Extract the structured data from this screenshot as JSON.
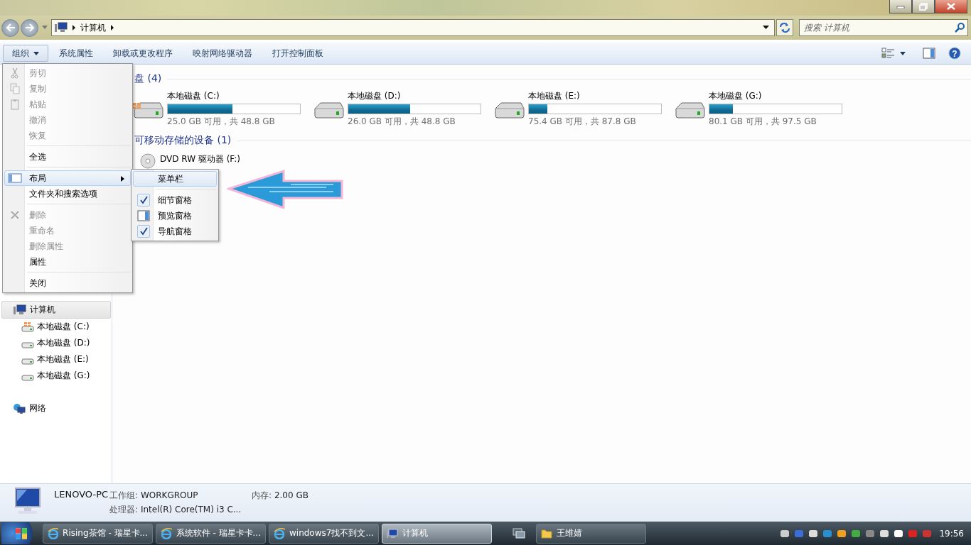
{
  "address": {
    "breadcrumb": [
      "计算机"
    ]
  },
  "search": {
    "placeholder": "搜索 计算机"
  },
  "toolbar": {
    "buttons": [
      {
        "label": "组织",
        "kind": "dropdown",
        "pressed": true
      },
      {
        "label": "系统属性",
        "kind": "plain",
        "pressed": false
      },
      {
        "label": "卸载或更改程序",
        "kind": "plain",
        "pressed": false
      },
      {
        "label": "映射网络驱动器",
        "kind": "plain",
        "pressed": false
      },
      {
        "label": "打开控制面板",
        "kind": "plain",
        "pressed": false
      }
    ],
    "help": "?"
  },
  "menu": {
    "items": [
      {
        "kind": "item",
        "label": "剪切",
        "disabled": true,
        "highlighted": false
      },
      {
        "kind": "item",
        "label": "复制",
        "disabled": true,
        "highlighted": false
      },
      {
        "kind": "item",
        "label": "粘贴",
        "disabled": true,
        "highlighted": false
      },
      {
        "kind": "item",
        "label": "撤消",
        "disabled": true,
        "highlighted": false
      },
      {
        "kind": "item",
        "label": "恢复",
        "disabled": true,
        "highlighted": false
      },
      {
        "kind": "separator"
      },
      {
        "kind": "item",
        "label": "全选",
        "disabled": false,
        "highlighted": false
      },
      {
        "kind": "separator"
      },
      {
        "kind": "submenu",
        "label": "布局",
        "disabled": false,
        "highlighted": true
      },
      {
        "kind": "item",
        "label": "文件夹和搜索选项",
        "disabled": false,
        "highlighted": false
      },
      {
        "kind": "separator"
      },
      {
        "kind": "item",
        "label": "删除",
        "disabled": true,
        "highlighted": false
      },
      {
        "kind": "item",
        "label": "重命名",
        "disabled": true,
        "highlighted": false
      },
      {
        "kind": "item",
        "label": "删除属性",
        "disabled": true,
        "highlighted": false
      },
      {
        "kind": "item",
        "label": "属性",
        "disabled": false,
        "highlighted": false
      },
      {
        "kind": "separator"
      },
      {
        "kind": "item",
        "label": "关闭",
        "disabled": false,
        "highlighted": false
      }
    ]
  },
  "submenu": {
    "items": [
      {
        "kind": "plain",
        "label": "菜单栏",
        "checked": false,
        "highlighted": true
      },
      {
        "kind": "separator"
      },
      {
        "kind": "plain",
        "label": "细节窗格",
        "checked": true,
        "highlighted": false
      },
      {
        "kind": "pane",
        "label": "预览窗格",
        "checked": false,
        "highlighted": false
      },
      {
        "kind": "plain",
        "label": "导航窗格",
        "checked": true,
        "highlighted": false
      }
    ]
  },
  "sections": [
    {
      "title": "盘 (4)",
      "drives": [
        {
          "kind": "system",
          "name": "本地磁盘 (C:)",
          "level": 0.49,
          "free": "25.0 GB 可用，共 48.8 GB"
        },
        {
          "kind": "data",
          "name": "本地磁盘 (D:)",
          "level": 0.47,
          "free": "26.0 GB 可用，共 48.8 GB"
        },
        {
          "kind": "data",
          "name": "本地磁盘 (E:)",
          "level": 0.14,
          "free": "75.4 GB 可用，共 87.8 GB"
        },
        {
          "kind": "data",
          "name": "本地磁盘 (G:)",
          "level": 0.18,
          "free": "80.1 GB 可用，共 97.5 GB"
        }
      ]
    },
    {
      "title": "可移动存储的设备 (1)",
      "drives": [
        {
          "kind": "dvd",
          "name": "DVD RW 驱动器 (F:)"
        }
      ]
    }
  ],
  "navigation": {
    "items": [
      {
        "kind": "computer",
        "label": "计算机",
        "selected": true,
        "children": [
          {
            "kind": "system",
            "label": "本地磁盘 (C:)",
            "selected": false
          },
          {
            "kind": "data",
            "label": "本地磁盘 (D:)",
            "selected": false
          },
          {
            "kind": "data",
            "label": "本地磁盘 (E:)",
            "selected": false
          },
          {
            "kind": "data",
            "label": "本地磁盘 (G:)",
            "selected": false
          }
        ]
      },
      {
        "kind": "network",
        "label": "网络",
        "selected": false
      }
    ]
  },
  "details": {
    "name": "LENOVO-PC",
    "fields": [
      {
        "label": "工作组:",
        "value": "WORKGROUP"
      },
      {
        "label": "内存:",
        "value": "2.00 GB"
      },
      {
        "label": "处理器:",
        "value": "Intel(R) Core(TM) i3 C..."
      }
    ]
  },
  "taskbar": {
    "tasks": [
      {
        "kind": "browser",
        "label": "Rising茶馆 - 瑞星卡...",
        "selected": false
      },
      {
        "kind": "browser",
        "label": "系统软件 - 瑞星卡卡...",
        "selected": false
      },
      {
        "kind": "browser",
        "label": "windows7找不到文...",
        "selected": false
      },
      {
        "kind": "computer",
        "label": "计算机",
        "selected": true
      },
      {
        "kind": "folder",
        "label": "王维婧",
        "selected": false
      }
    ],
    "clock": "19:56"
  }
}
